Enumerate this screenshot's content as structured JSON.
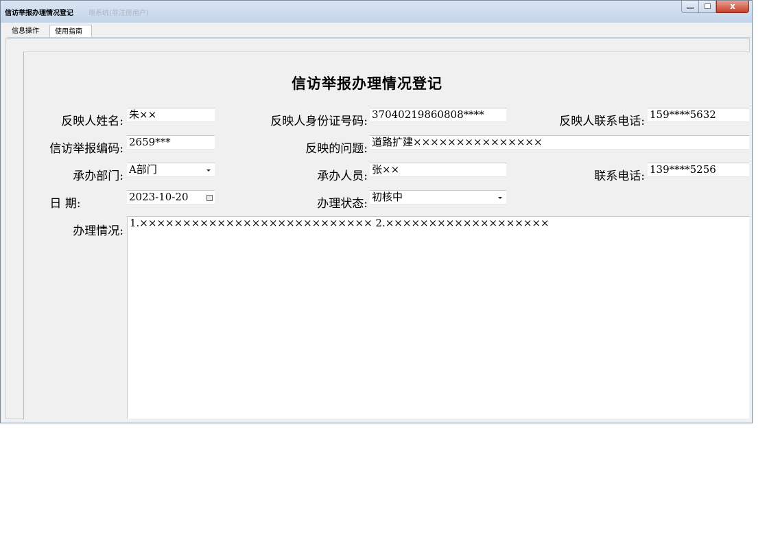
{
  "window": {
    "title": "信访举报办理情况登记",
    "subtitle": "理系统(非注册用户)",
    "close_glyph": "x"
  },
  "menu": {
    "tabs": [
      {
        "label": "信息操作"
      },
      {
        "label": "使用指南"
      }
    ]
  },
  "form": {
    "title": "信访举报办理情况登记",
    "name_label": "反映人姓名:",
    "name_value": "朱××",
    "id_label": "反映人身份证号码:",
    "id_value": "37040219860808****",
    "phone_label": "反映人联系电话:",
    "phone_value": "159****5632",
    "code_label": "信访举报编码:",
    "code_value": "2659***",
    "issue_label": "反映的问题:",
    "issue_value": "道路扩建×××××××××××××××",
    "dept_label": "承办部门:",
    "dept_value": "A部门",
    "handler_label": "承办人员:",
    "handler_value": "张××",
    "handler_phone_label": "联系电话:",
    "handler_phone_value": "139****5256",
    "date_label": "日  期:",
    "date_value": "2023-10-20",
    "status_label": "办理状态:",
    "status_value": "初核中",
    "process_label": "办理情况:",
    "process_value": "1.××××××××××××××××××××××××××× 2.×××××××××××××××××××"
  },
  "colors": {
    "title_bar": "#c3d4e9",
    "close_button": "#c7412b",
    "window_bg": "#f0f0f0"
  }
}
